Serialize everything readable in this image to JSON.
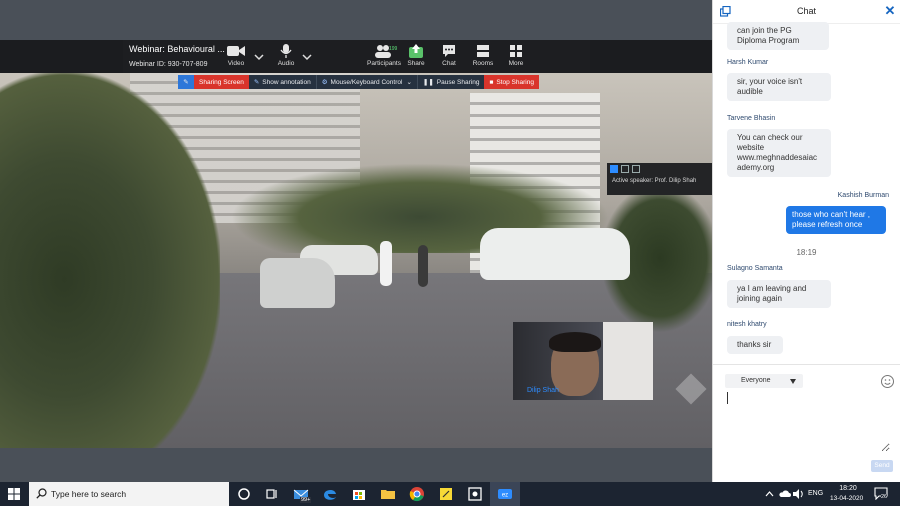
{
  "zoom": {
    "webinar_title": "Webinar: Behavioural ...",
    "webinar_id": "Webinar ID: 930-707-809",
    "buttons": {
      "video": "Video",
      "audio": "Audio",
      "participants": "Participants",
      "participants_count": "199",
      "share": "Share",
      "chat": "Chat",
      "rooms": "Rooms",
      "more": "More"
    },
    "share_bar": {
      "sharing_screen": "Sharing Screen",
      "show_annotation": "Show annotation",
      "mouse_keyboard": "Mouse/Keyboard Control",
      "pause_sharing": "Pause Sharing",
      "stop_sharing": "Stop Sharing"
    },
    "active_speaker": "Active speaker: Prof. Dilip Shah",
    "self_name": "Dilip Shah"
  },
  "chat": {
    "title": "Chat",
    "messages": [
      {
        "sender": "",
        "text_lines": [
          "can join the PG",
          "Diploma Program"
        ]
      },
      {
        "sender": "Harsh Kumar",
        "text_lines": [
          "sir,  your voice isn't",
          "audible"
        ]
      },
      {
        "sender": "Tarvene Bhasin",
        "text_lines": [
          "You can check our",
          "website",
          "www.meghnaddesaiac",
          "ademy.org"
        ]
      },
      {
        "sender": "Kashish Burman",
        "text_lines": [
          "those who can't hear ,",
          "please refresh once"
        ]
      },
      {
        "sender": "Sulagno Samanta",
        "text_lines": [
          "ya I am leaving and",
          "joining again"
        ]
      },
      {
        "sender": "nitesh khatry",
        "text_lines": [
          "thanks sir"
        ]
      }
    ],
    "time_separator": "18:19",
    "to_label": "Everyone",
    "send_label": "Send"
  },
  "taskbar": {
    "search_placeholder": "Type here to search",
    "badge": "99+",
    "lang": "ENG",
    "time": "18:20",
    "date": "13-04-2020",
    "notifications": "26"
  },
  "colors": {
    "accent": "#2d8cff",
    "stop_red": "#d9342b",
    "outgoing_bubble": "#1f78e6"
  }
}
